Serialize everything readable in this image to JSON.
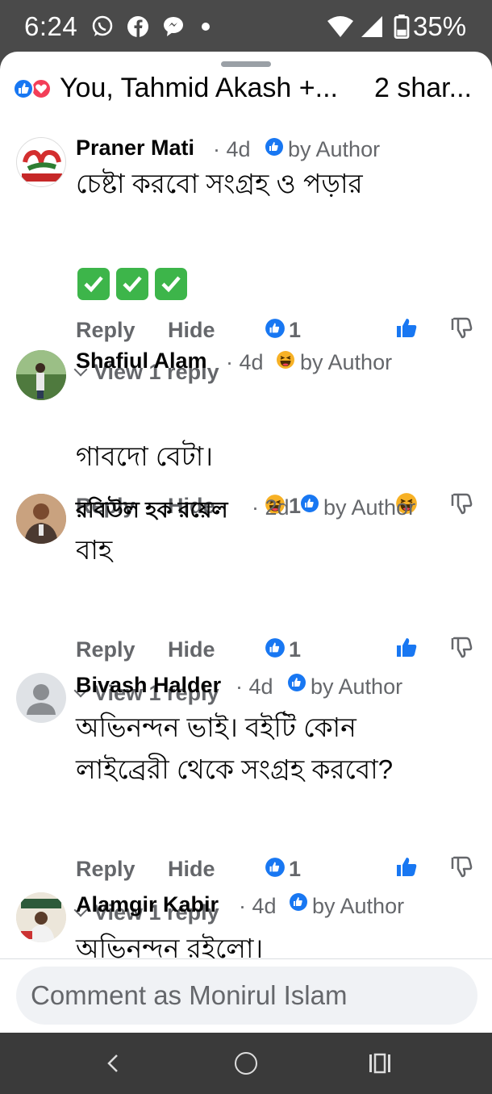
{
  "status_bar": {
    "time": "6:24",
    "battery": "35%",
    "icons": [
      "whatsapp-icon",
      "facebook-icon",
      "messenger-icon",
      "dot-icon",
      "wifi-icon",
      "signal-icon",
      "battery-icon"
    ]
  },
  "reactions_bar": {
    "names": "You, Tahmid Akash +...",
    "shares": "2 shar..."
  },
  "comments": [
    {
      "name": "Praner Mati",
      "meta": "· 4d",
      "badge": "by Author",
      "badge_icon": "like-reaction-icon",
      "text_lines": [
        "চেষ্টা করবো সংগ্রহ ও পড়ার"
      ],
      "emojis": [
        "check-mark-emoji",
        "check-mark-emoji",
        "check-mark-emoji"
      ],
      "actions": {
        "reply": "Reply",
        "hide": "Hide"
      },
      "reaction_count": "1",
      "reaction_icon": "like-reaction-icon",
      "view_replies": "View 1 reply"
    },
    {
      "name": "Shafiul Alam",
      "meta": "· 4d",
      "badge": "by Author",
      "badge_icon": "haha-reaction-icon",
      "text_lines": [
        "গাবদো বেটা।"
      ],
      "actions": {
        "reply": "Reply",
        "hide": "Hide"
      },
      "reaction_count": "1",
      "reaction_icon": "haha-reaction-icon"
    },
    {
      "name": "রবিউল হক রয়েল",
      "meta": "· 2d",
      "badge": "by Author",
      "badge_icon": "like-reaction-icon",
      "text_lines": [
        "বাহ"
      ],
      "actions": {
        "reply": "Reply",
        "hide": "Hide"
      },
      "reaction_count": "1",
      "reaction_icon": "like-reaction-icon",
      "view_replies": "View 1 reply"
    },
    {
      "name": "Bivash Halder",
      "meta": "· 4d",
      "badge": "by Author",
      "badge_icon": "like-reaction-icon",
      "text_lines": [
        "অভিনন্দন ভাই। বইটি কোন",
        "লাইব্রেরী থেকে সংগ্রহ করবো?"
      ],
      "actions": {
        "reply": "Reply",
        "hide": "Hide"
      },
      "reaction_count": "1",
      "reaction_icon": "like-reaction-icon",
      "view_replies": "View 1 reply"
    },
    {
      "name": "Alamgir Kabir",
      "meta": "· 4d",
      "badge": "by Author",
      "badge_icon": "like-reaction-icon",
      "text_lines": [
        "অভিনন্দন রইলো।"
      ]
    }
  ],
  "composer": {
    "placeholder": "Comment as Monirul Islam"
  },
  "nav_bar": {
    "icons": [
      "back-icon",
      "home-icon",
      "recent-apps-icon"
    ]
  },
  "colors": {
    "like_blue": "#1877f2",
    "love_red": "#f33e58",
    "secondary_text": "#65676b",
    "check_green": "#3db54a"
  }
}
